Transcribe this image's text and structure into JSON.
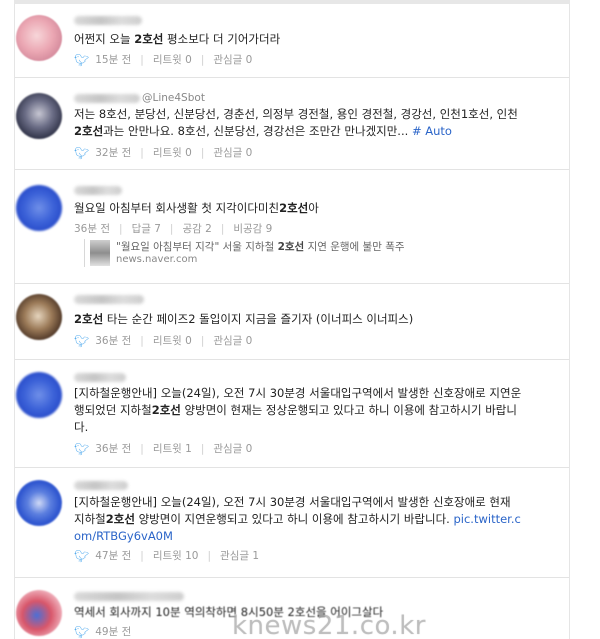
{
  "posts": [
    {
      "id": 1,
      "handle_suffix": "",
      "text_before": "어쩐지 오늘 ",
      "keyword": "2호선",
      "text_after": " 평소보다 더 기어가더라",
      "time": "15분 전",
      "retweet": "리트윗 0",
      "favorite": "관심글 0"
    },
    {
      "id": 2,
      "handle_suffix": "@Line4Sbot",
      "line1": "저는 8호선, 분당선, 신분당선, 경춘선, 의정부 경전철, 용인 경전철, 경강선, 인천1호선, 인천",
      "line2_keyword": "2호선",
      "line2_text": "과는 안만나요. 8호선, 신분당선, 경강선은 조만간 만나겠지만... ",
      "hashtag": "# Auto",
      "time": "32분 전",
      "retweet": "리트윗 0",
      "favorite": "관심글 0"
    },
    {
      "id": 3,
      "text_before": "월요일 아침부터 회사생활 첫 지각이다미친",
      "keyword": "2호선",
      "text_after": "아",
      "time": "36분 전",
      "reply": "답글 7",
      "like": "공감 2",
      "dislike": "비공감 9",
      "news_title_before": "\"월요일 아침부터 지각\" 서울 지하철 ",
      "news_keyword": "2호선",
      "news_title_after": " 지연 운행에 불만 폭주",
      "news_source": "news.naver.com"
    },
    {
      "id": 4,
      "keyword": "2호선",
      "text_after": " 타는 순간 페이즈2 돌입이지 지금을 즐기자 (이너피스 이너피스)",
      "time": "36분 전",
      "retweet": "리트윗 0",
      "favorite": "관심글 0"
    },
    {
      "id": 5,
      "line1": "[지하철운행안내] 오늘(24일), 오전 7시 30분경 서울대입구역에서 발생한 신호장애로 지연운",
      "line2_before": "행되었던 지하철",
      "line2_keyword": "2호선",
      "line2_after": " 양방면이 현재는 정상운행되고 있다고 하니 이용에 참고하시기 바랍니",
      "line3": "다.",
      "time": "36분 전",
      "retweet": "리트윗 1",
      "favorite": "관심글 0"
    },
    {
      "id": 6,
      "line1": "[지하철운행안내] 오늘(24일), 오전 7시 30분경 서울대입구역에서 발생한 신호장애로 현재",
      "line2_before": "지하철",
      "line2_keyword": "2호선",
      "line2_after": " 양방면이 지연운행되고 있다고 하니 이용에 참고하시기 바랍니다. ",
      "line2_link": "pic.twitter.c",
      "line3_link": "om/RTBGy6vA0M",
      "time": "47분 전",
      "retweet": "리트윗 10",
      "favorite": "관심글 1"
    },
    {
      "id": 7,
      "text": "역세서 회사까지 10분 역의착하면 8시50분 2호선을 어이그살다",
      "time": "49분 전"
    }
  ],
  "watermark": "knews21.co.kr"
}
